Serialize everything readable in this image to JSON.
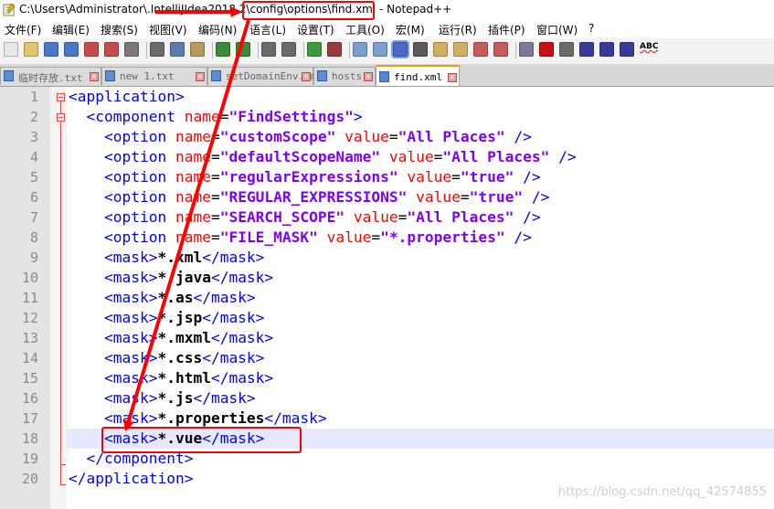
{
  "window": {
    "title_prefix": "C:\\Users\\Administrator\\.IntelliJIdea2018.2\\",
    "title_path_highlight": "config\\options\\find.xml",
    "title_suffix": " - Notepad++"
  },
  "menu": [
    "文件(F)",
    "编辑(E)",
    "搜索(S)",
    "视图(V)",
    "编码(N)",
    "语言(L)",
    "设置(T)",
    "工具(O)",
    "宏(M)",
    "运行(R)",
    "插件(P)",
    "窗口(W)",
    "?"
  ],
  "toolbar": {
    "buttons": [
      "new-file-icon",
      "open-file-icon",
      "save-icon",
      "save-all-icon",
      "close-icon",
      "close-all-icon",
      "print-icon",
      "cut-icon",
      "copy-icon",
      "paste-icon",
      "undo-icon",
      "redo-icon",
      "find-icon",
      "replace-icon",
      "zoom-in-icon",
      "zoom-out-icon",
      "sync-v-icon",
      "sync-h-icon",
      "word-wrap-icon",
      "show-all-chars-icon",
      "indent-guide-icon",
      "doc-map-icon",
      "function-list-icon",
      "folder-workspace-icon",
      "monitor-icon",
      "record-macro-icon",
      "stop-macro-icon",
      "play-macro-icon",
      "play-multi-macro-icon",
      "save-macro-icon",
      "spell-check-icon"
    ],
    "spellcheck_label": "ABC"
  },
  "tabs": [
    {
      "label": "临时存放.txt",
      "active": false
    },
    {
      "label": "new 1.txt",
      "active": false
    },
    {
      "label": "setDomainEnv.cmd",
      "active": false
    },
    {
      "label": "hosts",
      "active": false
    },
    {
      "label": "find.xml",
      "active": true
    }
  ],
  "editor": {
    "line_numbers": [
      "1",
      "2",
      "3",
      "4",
      "5",
      "6",
      "7",
      "8",
      "9",
      "10",
      "11",
      "12",
      "13",
      "14",
      "15",
      "16",
      "17",
      "18",
      "19",
      "20"
    ],
    "lines": [
      {
        "indent": "",
        "open": "<application>"
      },
      {
        "indent": "  ",
        "tag": "<component",
        "attrs": [
          {
            "name": " name",
            "eq": "=",
            "val": "\"FindSettings\""
          }
        ],
        "close": ">"
      },
      {
        "indent": "    ",
        "tag": "<option",
        "attrs": [
          {
            "name": " name",
            "eq": "=",
            "val": "\"customScope\""
          },
          {
            "name": " value",
            "eq": "=",
            "val": "\"All Places\""
          }
        ],
        "close": " />"
      },
      {
        "indent": "    ",
        "tag": "<option",
        "attrs": [
          {
            "name": " name",
            "eq": "=",
            "val": "\"defaultScopeName\""
          },
          {
            "name": " value",
            "eq": "=",
            "val": "\"All Places\""
          }
        ],
        "close": " />"
      },
      {
        "indent": "    ",
        "tag": "<option",
        "attrs": [
          {
            "name": " name",
            "eq": "=",
            "val": "\"regularExpressions\""
          },
          {
            "name": " value",
            "eq": "=",
            "val": "\"true\""
          }
        ],
        "close": " />"
      },
      {
        "indent": "    ",
        "tag": "<option",
        "attrs": [
          {
            "name": " name",
            "eq": "=",
            "val": "\"REGULAR_EXPRESSIONS\""
          },
          {
            "name": " value",
            "eq": "=",
            "val": "\"true\""
          }
        ],
        "close": " />"
      },
      {
        "indent": "    ",
        "tag": "<option",
        "attrs": [
          {
            "name": " name",
            "eq": "=",
            "val": "\"SEARCH_SCOPE\""
          },
          {
            "name": " value",
            "eq": "=",
            "val": "\"All Places\""
          }
        ],
        "close": " />"
      },
      {
        "indent": "    ",
        "tag": "<option",
        "attrs": [
          {
            "name": " name",
            "eq": "=",
            "val": "\"FILE_MASK\""
          },
          {
            "name": " value",
            "eq": "=",
            "val": "\"*.properties\""
          }
        ],
        "close": " />"
      },
      {
        "indent": "    ",
        "mask": "*.xml"
      },
      {
        "indent": "    ",
        "mask": "*.java"
      },
      {
        "indent": "    ",
        "mask": "*.as"
      },
      {
        "indent": "    ",
        "mask": "*.jsp"
      },
      {
        "indent": "    ",
        "mask": "*.mxml"
      },
      {
        "indent": "    ",
        "mask": "*.css"
      },
      {
        "indent": "    ",
        "mask": "*.html"
      },
      {
        "indent": "    ",
        "mask": "*.js"
      },
      {
        "indent": "    ",
        "mask": "*.properties"
      },
      {
        "indent": "    ",
        "mask": "*.vue"
      },
      {
        "indent": "  ",
        "open": "</component>"
      },
      {
        "indent": "",
        "open": "</application>"
      }
    ],
    "mask_open": "<mask>",
    "mask_close": "</mask>"
  },
  "watermark": "https://blog.csdn.net/qq_42574855",
  "colors": {
    "tag": "#0000ff",
    "attr_name": "#ff0000",
    "attr_value": "#8000ff",
    "annotation": "#ff0000",
    "active_tab_accent": "#f59b00"
  }
}
